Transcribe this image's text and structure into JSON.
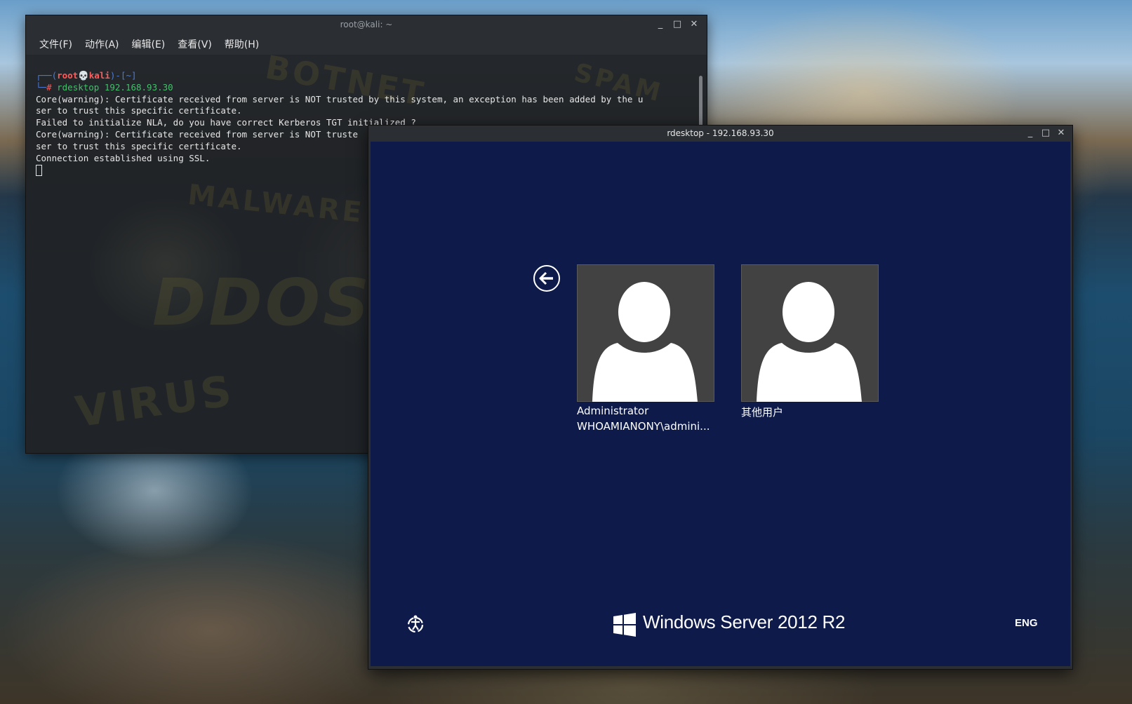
{
  "terminal": {
    "title": "root@kali: ~",
    "menu": [
      "文件(F)",
      "动作(A)",
      "编辑(E)",
      "查看(V)",
      "帮助(H)"
    ],
    "prompt_open": "┌──(",
    "prompt_user": "root💀kali",
    "prompt_dir": ")-[~]",
    "prompt_close": "└─",
    "prompt_hash": "# ",
    "command": "rdesktop 192.168.93.30",
    "output": [
      "Core(warning): Certificate received from server is NOT trusted by this system, an exception has been added by the u",
      "ser to trust this specific certificate.",
      "Failed to initialize NLA, do you have correct Kerberos TGT initialized ?",
      "Core(warning): Certificate received from server is NOT truste",
      "ser to trust this specific certificate.",
      "Connection established using SSL."
    ],
    "wallpaper_words": [
      "BOTNET",
      "SPAM",
      "MALWARE",
      "DDOS",
      "VIRUS"
    ]
  },
  "rdesktop": {
    "title": "rdesktop - 192.168.93.30",
    "users": [
      {
        "name": "Administrator",
        "account": "WHOAMIANONY\\admini..."
      },
      {
        "name": "其他用户",
        "account": ""
      }
    ],
    "brand": "Windows Server 2012 R2",
    "language": "ENG"
  },
  "controls": {
    "minimize": "_",
    "maximize": "□",
    "close": "✕"
  },
  "colors": {
    "login_bg": "#0d1a4a",
    "tile_bg": "#414241"
  }
}
